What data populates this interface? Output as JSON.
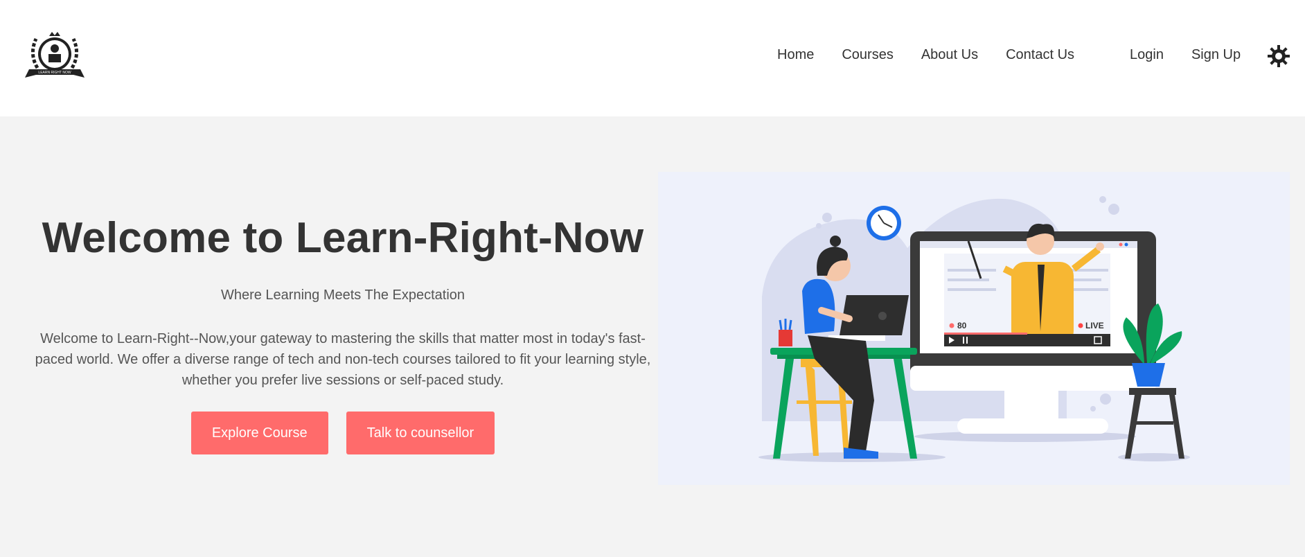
{
  "brand": {
    "logo_text": "LEARN RIGHT NOW",
    "logo_icon": "learn-right-now-logo"
  },
  "nav": {
    "home": "Home",
    "courses": "Courses",
    "about": "About Us",
    "contact": "Contact Us"
  },
  "auth": {
    "login": "Login",
    "signup": "Sign Up"
  },
  "theme_toggle_icon": "sun-icon",
  "hero": {
    "title": "Welcome to Learn-Right-Now",
    "subtitle": "Where Learning Meets The Expectation",
    "description": "Welcome to Learn-Right--Now,your gateway to mastering the skills that matter most in today's fast-paced world. We offer a diverse range of tech and non-tech courses tailored to fit your learning style, whether you prefer live sessions or self-paced study.",
    "explore_button": "Explore Course",
    "counsellor_button": "Talk to counsellor"
  },
  "illustration": {
    "viewers_count": "80",
    "live_badge": "LIVE"
  },
  "colors": {
    "accent": "#ff6b6b",
    "header_bg": "#ffffff",
    "page_bg": "#f3f3f3",
    "illustration_bg": "#eef1fb"
  }
}
